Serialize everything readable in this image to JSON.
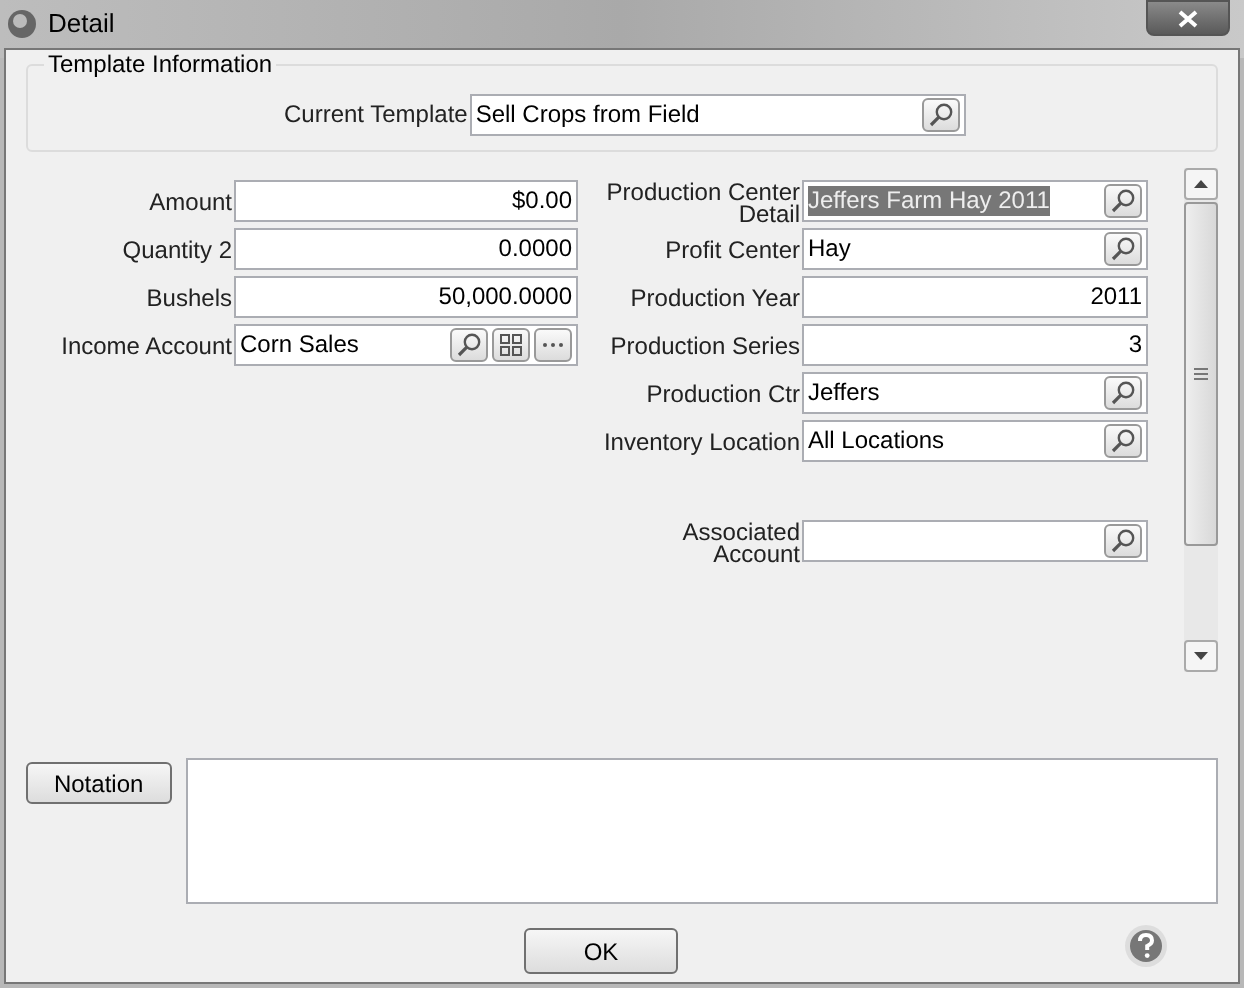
{
  "window": {
    "title": "Detail"
  },
  "template_group": {
    "legend": "Template Information",
    "label": "Current Template",
    "value": "Sell Crops from Field"
  },
  "left_fields": [
    {
      "label": "Amount",
      "value": "$0.00",
      "kind": "number",
      "text_selected": false
    },
    {
      "label": "Quantity 2",
      "value": "0.0000",
      "kind": "number",
      "text_selected": false
    },
    {
      "label": "Bushels",
      "value": "50,000.0000",
      "kind": "number",
      "text_selected": false
    },
    {
      "label": "Income Account",
      "value": "Corn Sales",
      "kind": "account",
      "text_selected": false
    }
  ],
  "right_fields": [
    {
      "label": "Production Center Detail",
      "value": "Jeffers Farm Hay 2011",
      "kind": "lookup",
      "text_selected": true
    },
    {
      "label": "Profit Center",
      "value": "Hay",
      "kind": "lookup",
      "text_selected": false
    },
    {
      "label": "Production Year",
      "value": "2011",
      "kind": "number",
      "text_selected": false
    },
    {
      "label": "Production Series",
      "value": "3",
      "kind": "number",
      "text_selected": false
    },
    {
      "label": "Production Ctr",
      "value": "Jeffers",
      "kind": "lookup",
      "text_selected": false
    },
    {
      "label": "Inventory Location",
      "value": "All Locations",
      "kind": "lookup",
      "text_selected": false
    },
    {
      "label": "Associated Account",
      "kind": "lookup",
      "gap_before": true
    }
  ],
  "notation_button": "Notation",
  "ok_button": "OK"
}
